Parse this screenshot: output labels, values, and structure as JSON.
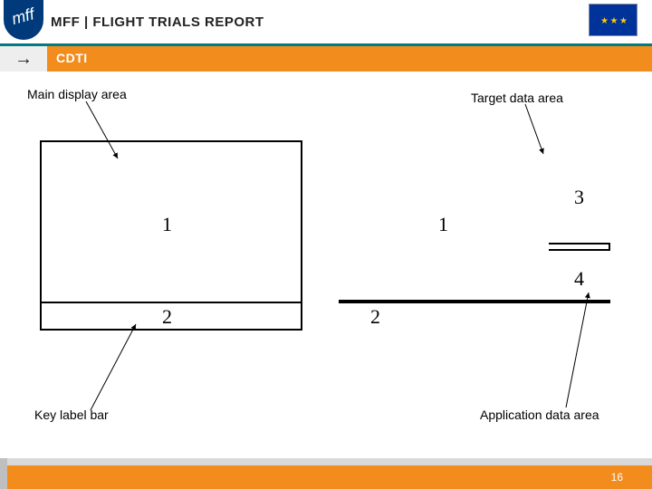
{
  "header": {
    "badge": "mff",
    "title": "MFF | FLIGHT TRIALS REPORT",
    "eu_flag_alt": "EU flag"
  },
  "section": {
    "arrow_glyph": "→",
    "title": "CDTI"
  },
  "labels": {
    "main": "Main display area",
    "target": "Target data area",
    "key": "Key label bar",
    "app": "Application data area"
  },
  "diagram": {
    "left": {
      "main": "1",
      "keybar": "2"
    },
    "right": {
      "main": "1",
      "keybar": "2",
      "target": "3",
      "appdata": "4"
    }
  },
  "footer": {
    "page": "16"
  }
}
